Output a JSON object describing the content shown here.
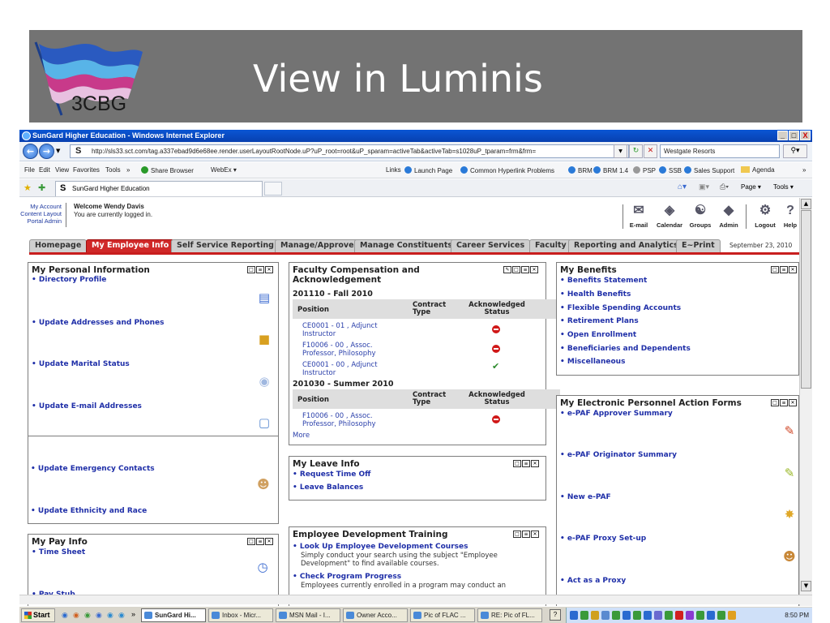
{
  "slide": {
    "logo_text": "3CBG",
    "title": "View in Luminis"
  },
  "window": {
    "title": "SunGard Higher Education - Windows Internet Explorer",
    "buttons": [
      "_",
      "□",
      "X"
    ]
  },
  "address": {
    "url": "http://sls33.sct.com/tag.a337ebad9d6e68ee.render.userLayoutRootNode.uP?uP_root=root&uP_sparam=activeTab&activeTab=s1028uP_tparam=frm&frm=",
    "search": "Westgate Resorts"
  },
  "menu": {
    "items": [
      "File",
      "Edit",
      "View",
      "Favorites",
      "Tools",
      "»"
    ],
    "share": "Share Browser",
    "webex": "WebEx ▾",
    "links_label": "Links",
    "links": [
      "Launch Page",
      "Common Hyperlink Problems",
      "BRM",
      "BRM 1.4",
      "PSP",
      "SSB",
      "Sales Support",
      "Agenda"
    ],
    "overflow": "»"
  },
  "favbar": {
    "tab_title": "SunGard Higher Education",
    "page_menu": "Page ▾",
    "tools_menu": "Tools ▾"
  },
  "user": {
    "links": [
      "My Account",
      "Content Layout",
      "Portal Admin"
    ],
    "welcome": "Welcome Wendy Davis",
    "status": "You are currently logged in."
  },
  "toolbar": {
    "icons": [
      {
        "label": "E-mail",
        "icon": "envelope-icon"
      },
      {
        "label": "Calendar",
        "icon": "calendar-icon"
      },
      {
        "label": "Groups",
        "icon": "groups-icon"
      },
      {
        "label": "Admin",
        "icon": "admin-icon"
      },
      {
        "label": "Logout",
        "icon": "logout-icon"
      },
      {
        "label": "Help",
        "icon": "help-icon"
      }
    ]
  },
  "tabs": [
    "Homepage",
    "My Employee Info",
    "Self Service Reporting",
    "Manage/Approve",
    "Manage Constituents",
    "Career Services",
    "Faculty",
    "Reporting and Analytics",
    "E~Print"
  ],
  "active_tab": "My Employee Info",
  "date": "September 23, 2010",
  "personal_info": {
    "title": "My Personal Information",
    "links": [
      "Directory Profile",
      "Update Addresses and Phones",
      "Update Marital Status",
      "Update E-mail Addresses",
      "Update Emergency Contacts",
      "Update Ethnicity and Race"
    ]
  },
  "pay_info": {
    "title": "My Pay Info",
    "links": [
      "Time Sheet",
      "Pay Stub"
    ]
  },
  "faculty": {
    "title_line1": "Faculty Compensation and",
    "title_line2": "Acknowledgement",
    "terms": [
      {
        "name": "201110 - Fall 2010",
        "rows": [
          {
            "pos1": "CE0001 - 01 , Adjunct",
            "pos2": "Instructor",
            "status": "not-acknowledged"
          },
          {
            "pos1": "F10006 - 00 , Assoc.",
            "pos2": "Professor, Philosophy",
            "status": "not-acknowledged"
          },
          {
            "pos1": "CE0001 - 00 , Adjunct",
            "pos2": "Instructor",
            "status": "acknowledged"
          }
        ]
      },
      {
        "name": "201030 - Summer 2010",
        "rows": [
          {
            "pos1": "F10006 - 00 , Assoc.",
            "pos2": "Professor, Philosophy",
            "status": "not-acknowledged"
          }
        ]
      }
    ],
    "headers": {
      "position": "Position",
      "contract1": "Contract",
      "contract2": "Type",
      "ack1": "Acknowledged",
      "ack2": "Status"
    },
    "more": "More"
  },
  "leave": {
    "title": "My Leave Info",
    "links": [
      "Request Time Off",
      "Leave Balances"
    ]
  },
  "training": {
    "title": "Employee Development Training",
    "items": [
      {
        "link": "Look Up Employee Development Courses",
        "text1": "Simply conduct your search using the subject \"Employee",
        "text2": "Development\" to find available courses."
      },
      {
        "link": "Check Program Progress",
        "text1": "Employees currently enrolled in a program may conduct an",
        "text2": ""
      }
    ]
  },
  "benefits": {
    "title": "My Benefits",
    "links": [
      "Benefits Statement",
      "Health Benefits",
      "Flexible Spending Accounts",
      "Retirement Plans",
      "Open Enrollment",
      "Beneficiaries and Dependents",
      "Miscellaneous"
    ]
  },
  "epaf": {
    "title": "My Electronic Personnel Action Forms",
    "links": [
      "e-PAF Approver Summary",
      "e-PAF Originator Summary",
      "New e-PAF",
      "e-PAF Proxy Set-up",
      "Act as a Proxy"
    ]
  },
  "taskbar": {
    "start": "Start",
    "buttons": [
      "SunGard Hi...",
      "Inbox - Micr...",
      "MSN Mail - I...",
      "Owner Acco...",
      "Pic of FLAC ...",
      "RE: Pic of FL..."
    ],
    "clock": "8:50 PM"
  }
}
